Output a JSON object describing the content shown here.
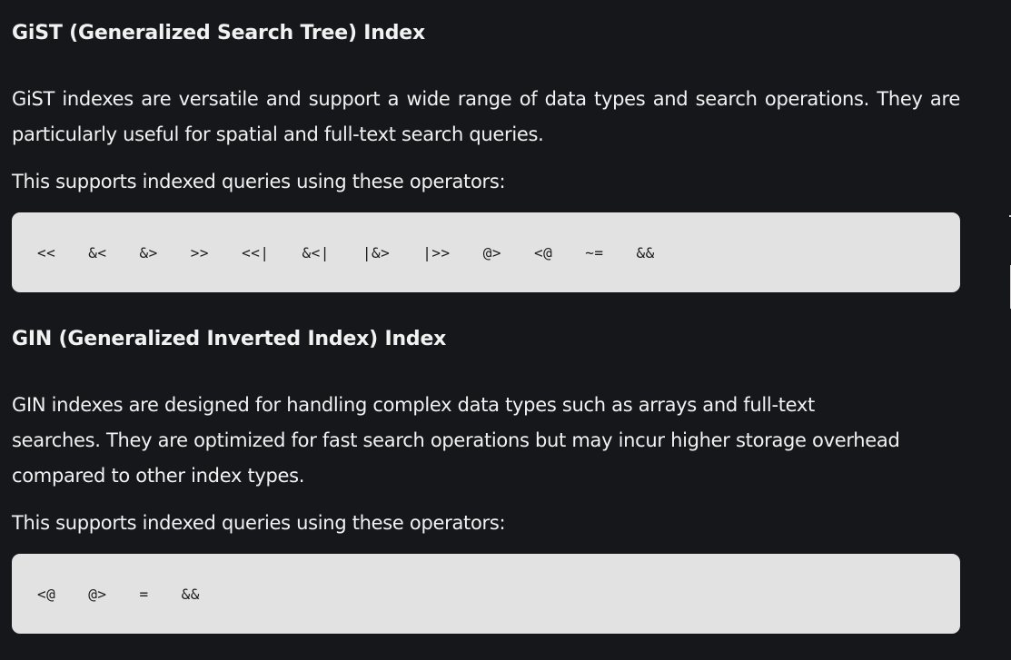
{
  "gist": {
    "title": "GiST (Generalized Search Tree) Index",
    "description": "GiST indexes are versatile and support a wide range of data types and search operations. They are particularly useful for spatial and full-text search queries.",
    "operators_intro": "This supports indexed queries using these operators:",
    "operators": [
      "<<",
      "&<",
      "&>",
      ">>",
      "<<|",
      "&<|",
      "|&>",
      "|>>",
      "@>",
      "<@",
      "~=",
      "&&"
    ]
  },
  "gin": {
    "title": "GIN (Generalized Inverted Index) Index",
    "description": "GIN indexes are designed for handling complex data types such as arrays and full-text searches. They are optimized for fast search operations but may incur higher storage overhead compared to other index types.",
    "operators_intro": "This supports indexed queries using these operators:",
    "operators": [
      "<@",
      "@>",
      "=",
      "&&"
    ]
  },
  "colors": {
    "background": "#16171b",
    "text": "#f2f2f2",
    "code_background": "#e2e2e2",
    "code_text": "#1c1c1c"
  }
}
